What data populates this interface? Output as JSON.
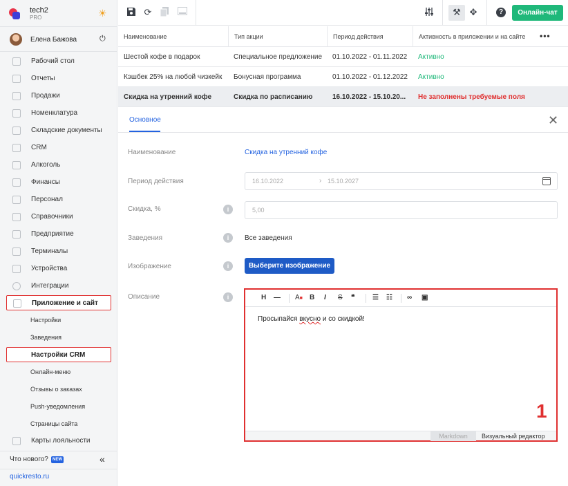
{
  "brand": {
    "name": "tech2",
    "plan": "PRO"
  },
  "user": {
    "name": "Елена Бажова"
  },
  "sidebar": {
    "items": [
      {
        "label": "Рабочий стол",
        "icon": "dashboard-icon"
      },
      {
        "label": "Отчеты",
        "icon": "reports-icon"
      },
      {
        "label": "Продажи",
        "icon": "sales-icon"
      },
      {
        "label": "Номенклатура",
        "icon": "nomenclature-icon"
      },
      {
        "label": "Складские документы",
        "icon": "warehouse-icon"
      },
      {
        "label": "CRM",
        "icon": "crm-icon"
      },
      {
        "label": "Алкоголь",
        "icon": "alcohol-icon"
      },
      {
        "label": "Финансы",
        "icon": "finance-icon"
      },
      {
        "label": "Персонал",
        "icon": "staff-icon"
      },
      {
        "label": "Справочники",
        "icon": "directory-icon"
      },
      {
        "label": "Предприятие",
        "icon": "enterprise-icon"
      },
      {
        "label": "Терминалы",
        "icon": "terminal-icon"
      },
      {
        "label": "Устройства",
        "icon": "device-icon"
      },
      {
        "label": "Интеграции",
        "icon": "integration-icon"
      }
    ],
    "app_section": "Приложение и сайт",
    "sub_items": [
      "Настройки",
      "Заведения",
      "Настройки CRM",
      "Онлайн-меню",
      "Отзывы о заказах",
      "Push-уведомления",
      "Страницы сайта"
    ],
    "loyalty": "Карты лояльности",
    "whats_new": "Что нового?",
    "new_badge": "NEW",
    "site": "quickresto.ru"
  },
  "toolbar": {
    "online_chat": "Онлайн-чат"
  },
  "table": {
    "headers": [
      "Наименование",
      "Тип акции",
      "Период действия",
      "Активность в приложении и на сайте"
    ],
    "rows": [
      [
        "Шестой кофе в подарок",
        "Специальное предложение",
        "01.10.2022 - 01.11.2022",
        "Активно"
      ],
      [
        "Кэшбек 25% на любой чизкейк",
        "Бонусная программа",
        "01.10.2022 - 01.12.2022",
        "Активно"
      ],
      [
        "Скидка на утренний кофе",
        "Скидка по расписанию",
        "16.10.2022 - 15.10.20...",
        "Не заполнены требуемые поля"
      ]
    ]
  },
  "detail": {
    "tab": "Основное",
    "fields": {
      "name_label": "Наименование",
      "name_value": "Скидка на утренний кофе",
      "period_label": "Период действия",
      "period_from": "16.10.2022",
      "period_to": "15.10.2027",
      "discount_label": "Скидка, %",
      "discount_placeholder": "5,00",
      "venues_label": "Заведения",
      "venues_value": "Все заведения",
      "image_label": "Изображение",
      "image_button": "Выберите изображение",
      "description_label": "Описание"
    },
    "editor": {
      "text_before": "Просыпайся ",
      "text_misspelled": "вкусно",
      "text_after": " и со скидкой!",
      "annotation": "1",
      "mode_markdown": "Markdown",
      "mode_visual": "Визуальный редактор"
    }
  },
  "colors": {
    "accent": "#2463e0",
    "success": "#1fb87a",
    "error": "#e03030",
    "button": "#1e5bc6"
  }
}
